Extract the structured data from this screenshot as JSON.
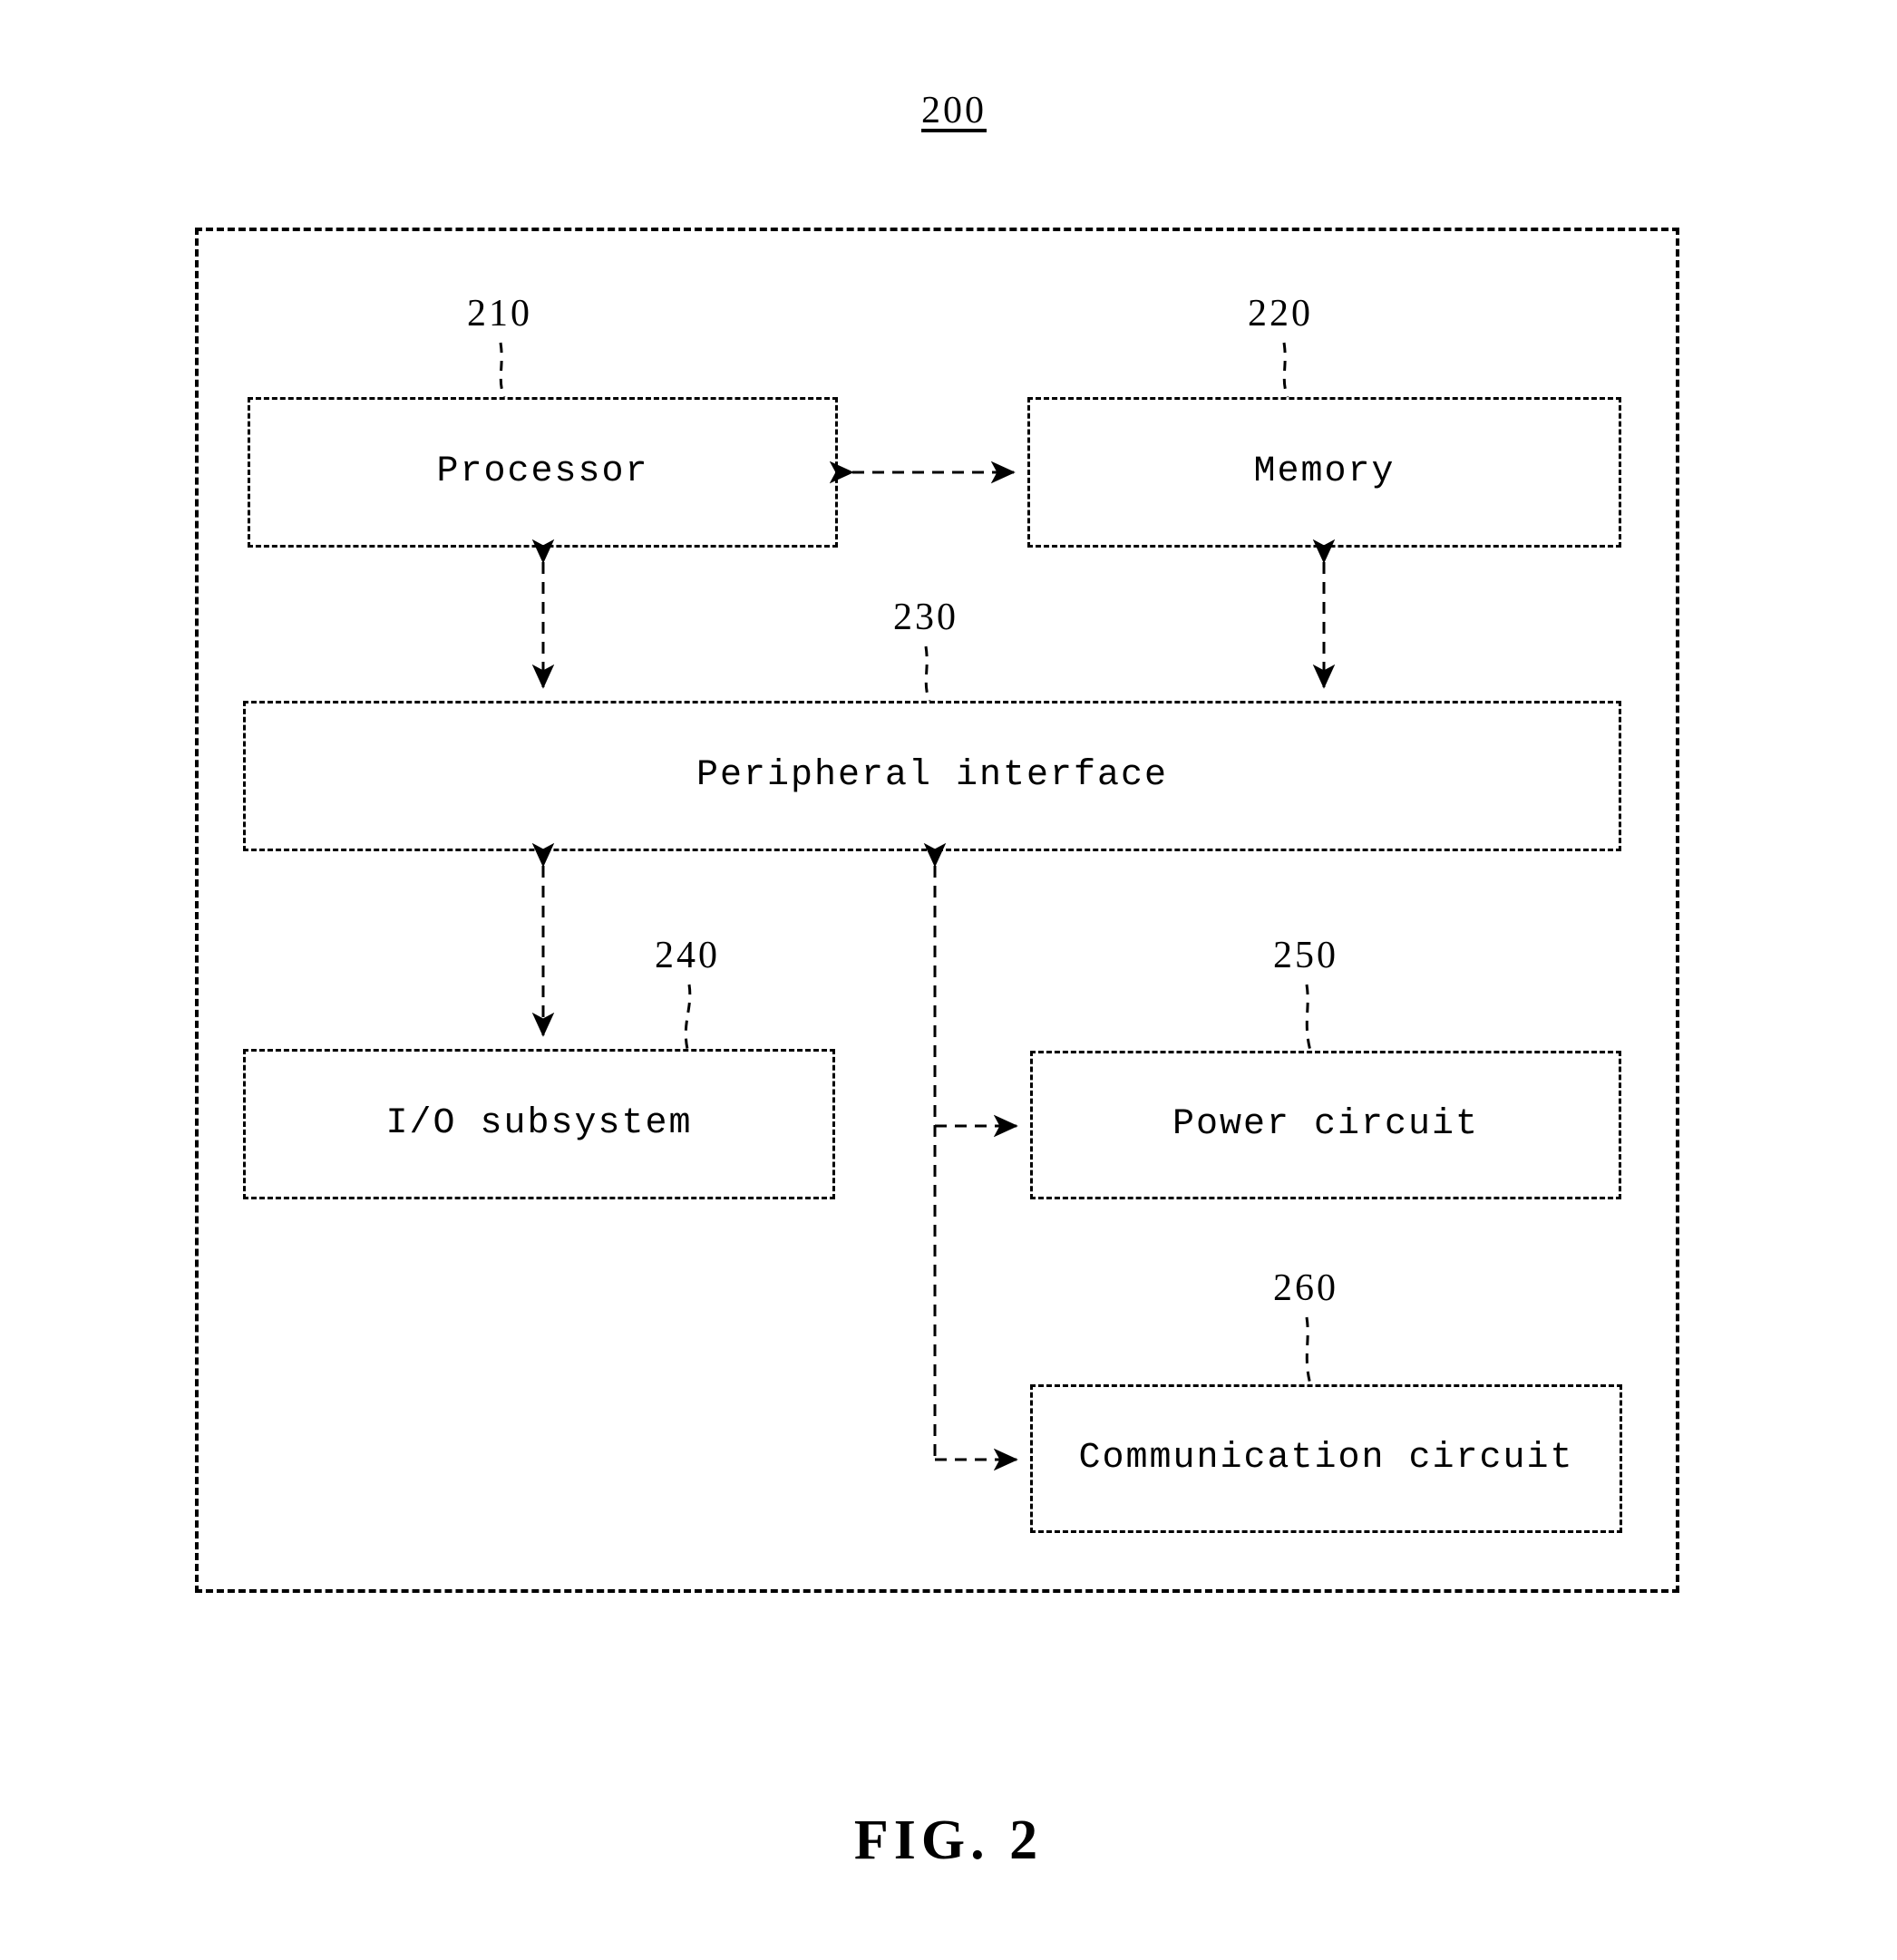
{
  "figure": {
    "caption": "FIG. 2",
    "system_numeral": "200"
  },
  "blocks": [
    {
      "id": "processor",
      "label": "Processor",
      "numeral": "210"
    },
    {
      "id": "memory",
      "label": "Memory",
      "numeral": "220"
    },
    {
      "id": "peripheral",
      "label": "Peripheral interface",
      "numeral": "230"
    },
    {
      "id": "io",
      "label": "I/O subsystem",
      "numeral": "240"
    },
    {
      "id": "power",
      "label": "Power circuit",
      "numeral": "250"
    },
    {
      "id": "communication",
      "label": "Communication circuit",
      "numeral": "260"
    }
  ],
  "connections": [
    {
      "from": "processor",
      "to": "memory",
      "style": "bidirectional"
    },
    {
      "from": "processor",
      "to": "peripheral",
      "style": "bidirectional"
    },
    {
      "from": "memory",
      "to": "peripheral",
      "style": "bidirectional"
    },
    {
      "from": "peripheral",
      "to": "io",
      "style": "bidirectional"
    },
    {
      "from": "peripheral",
      "to": "power",
      "style": "unidirectional"
    },
    {
      "from": "peripheral",
      "to": "communication",
      "style": "unidirectional"
    }
  ],
  "colors": {
    "line": "#000000",
    "background": "#ffffff"
  }
}
